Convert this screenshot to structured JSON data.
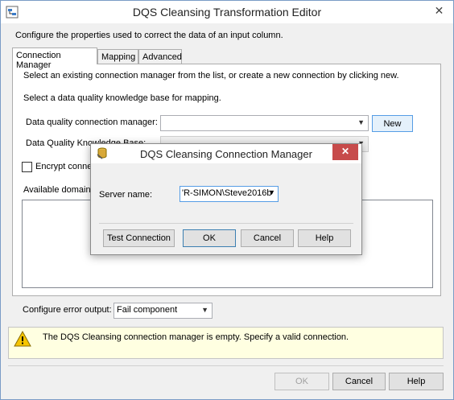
{
  "window": {
    "title": "DQS Cleansing Transformation Editor",
    "close_glyph": "✕",
    "description": "Configure the properties used to correct the data of an input column."
  },
  "tabs": [
    {
      "label": "Connection Manager"
    },
    {
      "label": "Mapping"
    },
    {
      "label": "Advanced"
    }
  ],
  "connection_tab": {
    "instruction_1": "Select an existing connection manager from the list, or create a new connection by clicking new.",
    "instruction_2": "Select a data quality knowledge base for mapping.",
    "dq_connection_label": "Data quality connection manager:",
    "dq_connection_value": "",
    "new_button": "New",
    "kb_label": "Data Quality Knowledge Base:",
    "kb_value": "",
    "encrypt_label": "Encrypt connection",
    "available_domains_label": "Available domains:"
  },
  "error_output": {
    "label": "Configure error output:",
    "value": "Fail component"
  },
  "warning": {
    "message": "The DQS Cleansing connection manager is empty. Specify a valid connection."
  },
  "footer": {
    "ok": "OK",
    "cancel": "Cancel",
    "help": "Help"
  },
  "dialog": {
    "title": "DQS Cleansing Connection Manager",
    "close_glyph": "✕",
    "server_label": "Server name:",
    "server_value": "'R-SIMON\\Steve2016b",
    "test_connection": "Test Connection",
    "ok": "OK",
    "cancel": "Cancel",
    "help": "Help"
  },
  "colors": {
    "accent": "#569de5",
    "close_red": "#c74b4b",
    "warning_bg": "#ffffe1"
  }
}
